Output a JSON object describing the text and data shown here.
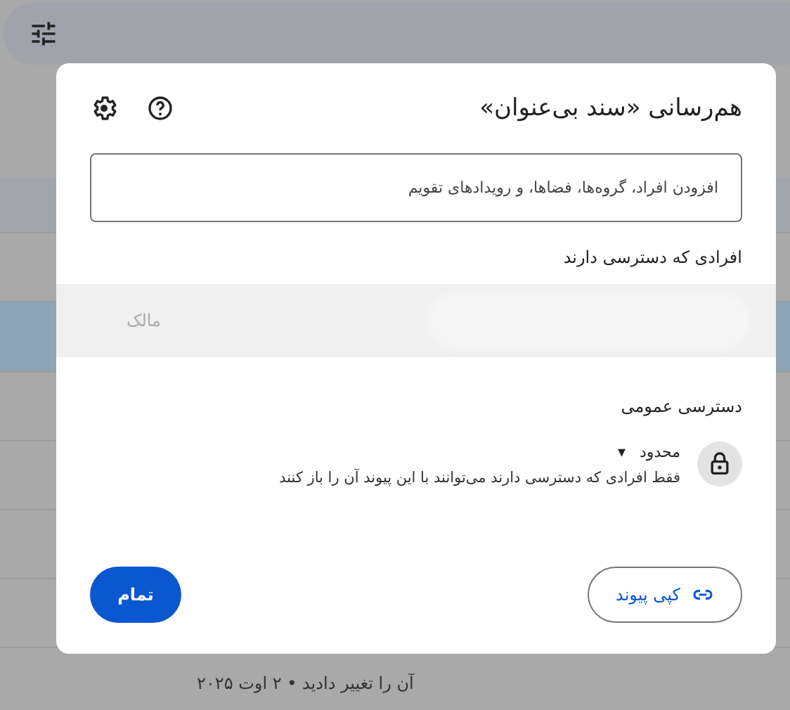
{
  "dialog": {
    "title": "هم‌رسانی «سند بی‌عنوان»",
    "search": {
      "placeholder": "افزودن افراد، گروه‌ها، فضاها، و رویدادهای تقویم"
    },
    "people_heading": "افرادی که دسترسی دارند",
    "people": [
      {
        "role": "مالک"
      }
    ],
    "general_access_heading": "دسترسی عمومی",
    "general_access": {
      "value": "محدود",
      "caret": "▾",
      "description": "فقط افرادی که دسترسی دارند می‌توانند با این پیوند آن را باز کنند"
    },
    "buttons": [
      {
        "kind": "outlined",
        "label": "کپی پیوند"
      },
      {
        "kind": "filled",
        "label": "تمام"
      }
    ]
  },
  "background": {
    "modified_text": "آن را تغییر دادید • ۲ اوت ۲۰۲۵"
  }
}
